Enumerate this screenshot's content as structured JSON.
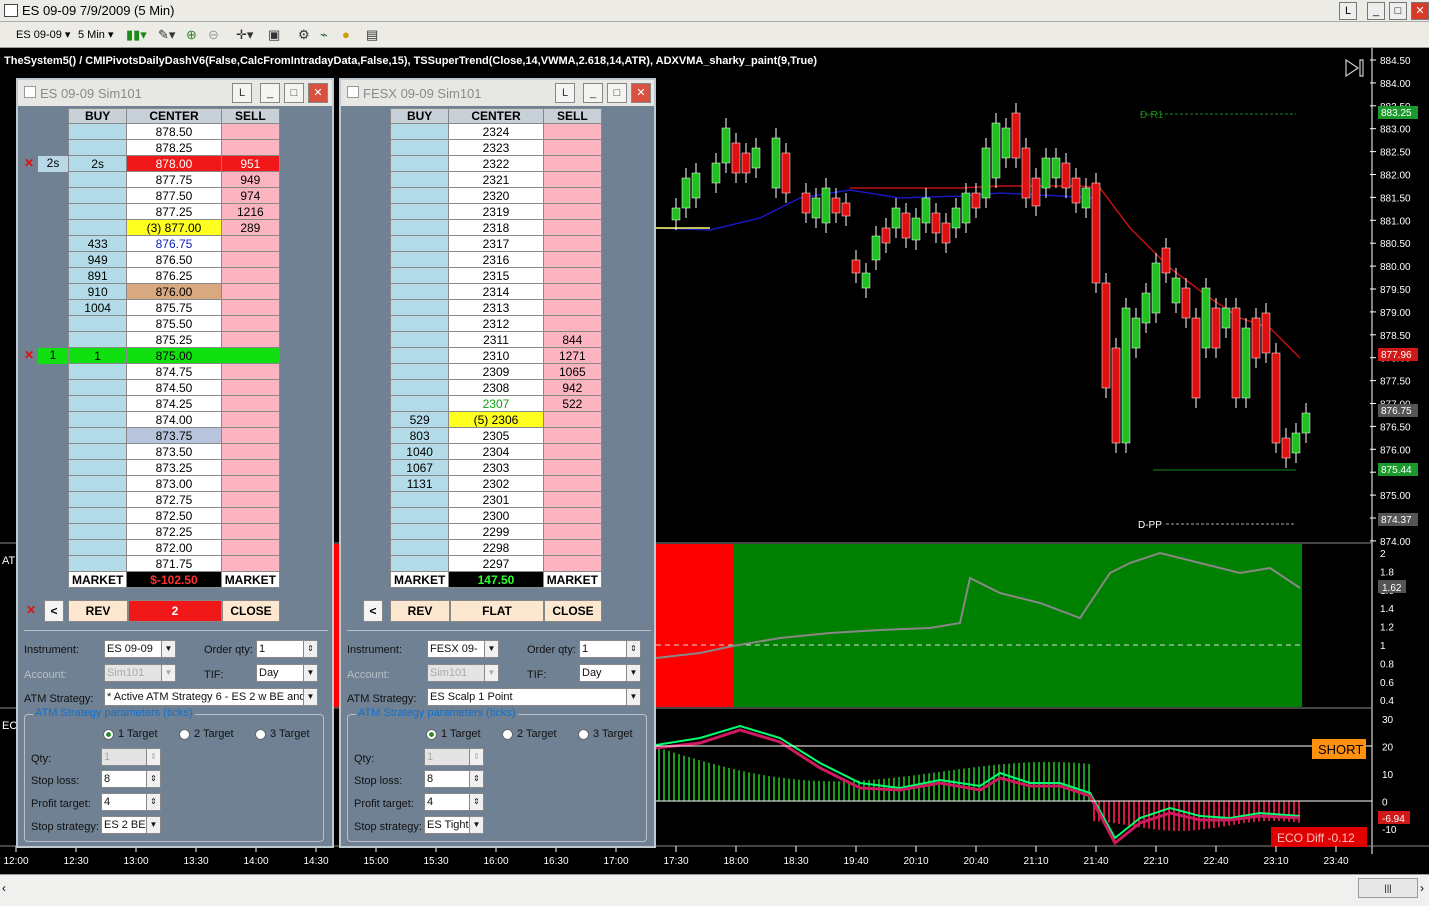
{
  "window": {
    "title": "ES 09-09  7/9/2009 (5 Min)"
  },
  "toolbar": {
    "instrument": "ES 09-09",
    "interval": "5 Min"
  },
  "chart": {
    "indicator_label": "TheSystem5() / CMIPivotsDailyDashV6(False,CalcFromIntradayData,False,15), TSSuperTrend(Close,14,VWMA,2.618,14,ATR), ADXVMA_sharky_paint(9,True)",
    "price_ticks": [
      "884.50",
      "884.00",
      "883.50",
      "883.00",
      "882.50",
      "882.00",
      "881.50",
      "881.00",
      "880.50",
      "880.00",
      "879.50",
      "879.00",
      "878.50",
      "878.00",
      "877.50",
      "877.00",
      "876.50",
      "876.00",
      "875.50",
      "875.00",
      "874.50",
      "874.00"
    ],
    "price_badges": [
      {
        "text": "883.25",
        "color": "#1a9a2a"
      },
      {
        "text": "877.96",
        "color": "#d01818"
      },
      {
        "text": "876.75",
        "color": "#555555"
      },
      {
        "text": "875.44",
        "color": "#1a9a2a"
      },
      {
        "text": "874.37",
        "color": "#555555"
      }
    ],
    "pivot_labels": [
      "D-R1",
      "D-PP"
    ],
    "time_labels": [
      "12:00",
      "12:30",
      "13:00",
      "13:30",
      "14:00",
      "14:30",
      "15:00",
      "15:30",
      "16:00",
      "16:30",
      "17:00",
      "17:30",
      "18:00",
      "18:30",
      "19:40",
      "20:10",
      "20:40",
      "21:10",
      "21:40",
      "22:10",
      "22:40",
      "23:10",
      "23:40"
    ],
    "panel2_ticks": [
      "2",
      "1.8",
      "1.6",
      "1.4",
      "1.2",
      "1",
      "0.8",
      "0.6",
      "0.4"
    ],
    "panel2_value": "1.62",
    "panel3_ticks": [
      "30",
      "20",
      "10",
      "0",
      "-10"
    ],
    "panel3_value": "-6.94",
    "short_label": "SHORT",
    "eco_label": "ECO Diff -0.12",
    "left_labels": [
      "AT",
      "EC"
    ]
  },
  "dom_left": {
    "title": "ES 09-09 Sim101",
    "headers": [
      "BUY",
      "CENTER",
      "SELL"
    ],
    "rows": [
      {
        "buy": "",
        "center": "878.50",
        "sell": "",
        "c": "n"
      },
      {
        "buy": "",
        "center": "878.25",
        "sell": "",
        "c": "n"
      },
      {
        "buy": "2s",
        "center": "878.00",
        "sell": "951",
        "c": "red",
        "mark": "x"
      },
      {
        "buy": "",
        "center": "877.75",
        "sell": "949",
        "c": "n"
      },
      {
        "buy": "",
        "center": "877.50",
        "sell": "974",
        "c": "n"
      },
      {
        "buy": "",
        "center": "877.25",
        "sell": "1216",
        "c": "n"
      },
      {
        "buy": "",
        "center": "(3) 877.00",
        "sell": "289",
        "c": "yellow"
      },
      {
        "buy": "433",
        "center": "876.75",
        "sell": "",
        "c": "blue"
      },
      {
        "buy": "949",
        "center": "876.50",
        "sell": "",
        "c": "n"
      },
      {
        "buy": "891",
        "center": "876.25",
        "sell": "",
        "c": "n"
      },
      {
        "buy": "910",
        "center": "876.00",
        "sell": "",
        "c": "tan"
      },
      {
        "buy": "1004",
        "center": "875.75",
        "sell": "",
        "c": "n"
      },
      {
        "buy": "",
        "center": "875.50",
        "sell": "",
        "c": "n"
      },
      {
        "buy": "",
        "center": "875.25",
        "sell": "",
        "c": "n"
      },
      {
        "buy": "1",
        "center": "875.00",
        "sell": "",
        "c": "green",
        "mark": "x"
      },
      {
        "buy": "",
        "center": "874.75",
        "sell": "",
        "c": "n"
      },
      {
        "buy": "",
        "center": "874.50",
        "sell": "",
        "c": "n"
      },
      {
        "buy": "",
        "center": "874.25",
        "sell": "",
        "c": "n"
      },
      {
        "buy": "",
        "center": "874.00",
        "sell": "",
        "c": "n"
      },
      {
        "buy": "",
        "center": "873.75",
        "sell": "",
        "c": "gray"
      },
      {
        "buy": "",
        "center": "873.50",
        "sell": "",
        "c": "n"
      },
      {
        "buy": "",
        "center": "873.25",
        "sell": "",
        "c": "n"
      },
      {
        "buy": "",
        "center": "873.00",
        "sell": "",
        "c": "n"
      },
      {
        "buy": "",
        "center": "872.75",
        "sell": "",
        "c": "n"
      },
      {
        "buy": "",
        "center": "872.50",
        "sell": "",
        "c": "n"
      },
      {
        "buy": "",
        "center": "872.25",
        "sell": "",
        "c": "n"
      },
      {
        "buy": "",
        "center": "872.00",
        "sell": "",
        "c": "n"
      },
      {
        "buy": "",
        "center": "871.75",
        "sell": "",
        "c": "n"
      }
    ],
    "market_buy": "MARKET",
    "pnl": "$-102.50",
    "market_sell": "MARKET",
    "btn_rev": "REV",
    "btn_mid": "2",
    "btn_close": "CLOSE",
    "btn_back": "<",
    "form": {
      "instrument_label": "Instrument:",
      "instrument": "ES 09-09",
      "orderqty_label": "Order qty:",
      "orderqty": "1",
      "account_label": "Account:",
      "account": "Sim101",
      "tif_label": "TIF:",
      "tif": "Day",
      "atm_label": "ATM Strategy:",
      "atm": "* Active ATM Strategy 6 - ES 2 w BE and",
      "group_title": "ATM Strategy parameters (ticks)",
      "t1": "1 Target",
      "t2": "2 Target",
      "t3": "3 Target",
      "qty_label": "Qty:",
      "qty": "1",
      "stoploss_label": "Stop loss:",
      "stoploss": "8",
      "profit_label": "Profit target:",
      "profit": "4",
      "stopstrat_label": "Stop strategy:",
      "stopstrat": "ES 2 BE"
    }
  },
  "dom_right": {
    "title": "FESX 09-09 Sim101",
    "headers": [
      "BUY",
      "CENTER",
      "SELL"
    ],
    "rows": [
      {
        "buy": "",
        "center": "2324",
        "sell": "",
        "c": "n"
      },
      {
        "buy": "",
        "center": "2323",
        "sell": "",
        "c": "n"
      },
      {
        "buy": "",
        "center": "2322",
        "sell": "",
        "c": "n"
      },
      {
        "buy": "",
        "center": "2321",
        "sell": "",
        "c": "n"
      },
      {
        "buy": "",
        "center": "2320",
        "sell": "",
        "c": "n"
      },
      {
        "buy": "",
        "center": "2319",
        "sell": "",
        "c": "n"
      },
      {
        "buy": "",
        "center": "2318",
        "sell": "",
        "c": "n"
      },
      {
        "buy": "",
        "center": "2317",
        "sell": "",
        "c": "n"
      },
      {
        "buy": "",
        "center": "2316",
        "sell": "",
        "c": "n"
      },
      {
        "buy": "",
        "center": "2315",
        "sell": "",
        "c": "n"
      },
      {
        "buy": "",
        "center": "2314",
        "sell": "",
        "c": "n"
      },
      {
        "buy": "",
        "center": "2313",
        "sell": "",
        "c": "n"
      },
      {
        "buy": "",
        "center": "2312",
        "sell": "",
        "c": "n"
      },
      {
        "buy": "",
        "center": "2311",
        "sell": "844",
        "c": "n"
      },
      {
        "buy": "",
        "center": "2310",
        "sell": "1271",
        "c": "n"
      },
      {
        "buy": "",
        "center": "2309",
        "sell": "1065",
        "c": "n"
      },
      {
        "buy": "",
        "center": "2308",
        "sell": "942",
        "c": "n"
      },
      {
        "buy": "",
        "center": "2307",
        "sell": "522",
        "c": "greentext"
      },
      {
        "buy": "529",
        "center": "(5) 2306",
        "sell": "",
        "c": "yellow"
      },
      {
        "buy": "803",
        "center": "2305",
        "sell": "",
        "c": "n"
      },
      {
        "buy": "1040",
        "center": "2304",
        "sell": "",
        "c": "n"
      },
      {
        "buy": "1067",
        "center": "2303",
        "sell": "",
        "c": "n"
      },
      {
        "buy": "1131",
        "center": "2302",
        "sell": "",
        "c": "n"
      },
      {
        "buy": "",
        "center": "2301",
        "sell": "",
        "c": "n"
      },
      {
        "buy": "",
        "center": "2300",
        "sell": "",
        "c": "n"
      },
      {
        "buy": "",
        "center": "2299",
        "sell": "",
        "c": "n"
      },
      {
        "buy": "",
        "center": "2298",
        "sell": "",
        "c": "n"
      },
      {
        "buy": "",
        "center": "2297",
        "sell": "",
        "c": "n"
      }
    ],
    "market_buy": "MARKET",
    "pnl": "147.50",
    "market_sell": "MARKET",
    "btn_rev": "REV",
    "btn_mid": "FLAT",
    "btn_close": "CLOSE",
    "btn_back": "<",
    "form": {
      "instrument_label": "Instrument:",
      "instrument": "FESX 09-",
      "orderqty_label": "Order qty:",
      "orderqty": "1",
      "account_label": "Account:",
      "account": "Sim101",
      "tif_label": "TIF:",
      "tif": "Day",
      "atm_label": "ATM Strategy:",
      "atm": "ES Scalp 1 Point",
      "group_title": "ATM Strategy parameters (ticks)",
      "t1": "1 Target",
      "t2": "2 Target",
      "t3": "3 Target",
      "qty_label": "Qty:",
      "qty": "1",
      "stoploss_label": "Stop loss:",
      "stoploss": "8",
      "profit_label": "Profit target:",
      "profit": "4",
      "stopstrat_label": "Stop strategy:",
      "stopstrat": "ES Tight"
    }
  }
}
